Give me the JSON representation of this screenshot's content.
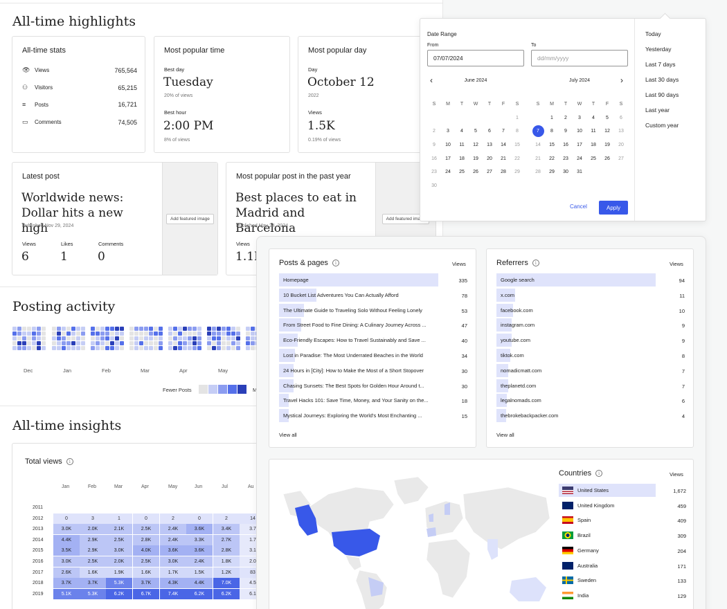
{
  "highlights": {
    "title": "All-time highlights",
    "stats": {
      "title": "All-time stats",
      "rows": [
        {
          "icon": "eye-icon",
          "label": "Views",
          "value": "765,564"
        },
        {
          "icon": "visitors-icon",
          "label": "Visitors",
          "value": "65,215"
        },
        {
          "icon": "posts-icon",
          "label": "Posts",
          "value": "16,721"
        },
        {
          "icon": "comments-icon",
          "label": "Comments",
          "value": "74,505"
        }
      ]
    },
    "popular_time": {
      "title": "Most popular time",
      "best_day_label": "Best day",
      "best_day": "Tuesday",
      "best_day_pct": "20% of views",
      "best_hour_label": "Best hour",
      "best_hour": "2:00 PM",
      "best_hour_pct": "8% of views"
    },
    "popular_day": {
      "title": "Most popular day",
      "day_label": "Day",
      "day": "October 12",
      "year": "2022",
      "views_label": "Views",
      "views": "1.5K",
      "views_pct": "0.19% of views"
    },
    "latest_post": {
      "title": "Latest post",
      "headline": "Worldwide news: Dollar hits a new high",
      "published": "Published Nov 29, 2024",
      "add_image": "Add featured image",
      "metrics": [
        {
          "label": "Views",
          "value": "6"
        },
        {
          "label": "Likes",
          "value": "1"
        },
        {
          "label": "Comments",
          "value": "0"
        }
      ]
    },
    "popular_post": {
      "title": "Most popular post in the past year",
      "headline": "Best places to eat in Madrid and Barcelona",
      "published": "Published May 24, 2024",
      "add_image": "Add featured image",
      "views_label": "Views",
      "views": "1.1K"
    }
  },
  "posting_activity": {
    "title": "Posting activity",
    "months": [
      "Dec",
      "Jan",
      "Feb",
      "Mar",
      "Apr",
      "May"
    ],
    "legend_low": "Fewer Posts",
    "legend_high": "M"
  },
  "insights": {
    "title": "All-time insights",
    "total_views_title": "Total views",
    "months": [
      "Jan",
      "Feb",
      "Mar",
      "Apr",
      "May",
      "Jun",
      "Jul",
      "Au"
    ],
    "years": [
      "2011",
      "2012",
      "2013",
      "2014",
      "2015",
      "2016",
      "2017",
      "2018",
      "2019"
    ],
    "rows": [
      [
        "",
        "",
        "",
        "",
        "",
        "",
        "",
        ""
      ],
      [
        "0",
        "3",
        "1",
        "0",
        "2",
        "0",
        "2",
        "14"
      ],
      [
        "3.0K",
        "2.0K",
        "2.1K",
        "2.5K",
        "2.4K",
        "3.6K",
        "3.4K",
        "3.7"
      ],
      [
        "4.4K",
        "2.9K",
        "2.5K",
        "2.8K",
        "2.4K",
        "3.3K",
        "2.7K",
        "1.7"
      ],
      [
        "3.5K",
        "2.9K",
        "3.0K",
        "4.0K",
        "3.6K",
        "3.6K",
        "2.8K",
        "3.1"
      ],
      [
        "3.0K",
        "2.5K",
        "2.0K",
        "2.5K",
        "3.0K",
        "2.4K",
        "1.8K",
        "2.0"
      ],
      [
        "2.6K",
        "1.6K",
        "1.9K",
        "1.6K",
        "1.7K",
        "1.5K",
        "1.2K",
        "83"
      ],
      [
        "3.7K",
        "3.7K",
        "5.3K",
        "3.7K",
        "4.3K",
        "4.4K",
        "7.0K",
        "4.5"
      ],
      [
        "5.1K",
        "5.3K",
        "6.2K",
        "6.7K",
        "7.4K",
        "6.2K",
        "6.2K",
        "6.1"
      ]
    ]
  },
  "datepicker": {
    "range_label": "Date Range",
    "from_label": "From",
    "from_value": "07/07/2024",
    "to_label": "To",
    "to_placeholder": "dd/mm/yyyy",
    "left_month": "June 2024",
    "right_month": "July 2024",
    "weekdays": [
      "S",
      "M",
      "T",
      "W",
      "T",
      "F",
      "S"
    ],
    "june_days": [
      "",
      "",
      "",
      "",
      "",
      "",
      "1",
      "2",
      "3",
      "4",
      "5",
      "6",
      "7",
      "8",
      "9",
      "10",
      "11",
      "12",
      "13",
      "14",
      "15",
      "16",
      "17",
      "18",
      "19",
      "20",
      "21",
      "22",
      "23",
      "24",
      "25",
      "26",
      "27",
      "28",
      "29",
      "30"
    ],
    "july_days": [
      "",
      "1",
      "2",
      "3",
      "4",
      "5",
      "6",
      "7",
      "8",
      "9",
      "10",
      "11",
      "12",
      "13",
      "14",
      "15",
      "16",
      "17",
      "18",
      "19",
      "20",
      "21",
      "22",
      "23",
      "24",
      "25",
      "26",
      "27",
      "28",
      "29",
      "30",
      "31"
    ],
    "selected_day": "7",
    "cancel_label": "Cancel",
    "apply_label": "Apply",
    "presets": [
      "Today",
      "Yesterday",
      "Last 7 days",
      "Last 30 days",
      "Last 90 days",
      "Last year",
      "Custom year"
    ]
  },
  "posts_pages": {
    "title": "Posts & pages",
    "views_header": "Views",
    "rows": [
      {
        "label": "Homepage",
        "value": "335"
      },
      {
        "label": "10 Bucket List Adventures You Can Actually Afford",
        "value": "78"
      },
      {
        "label": "The Ultimate Guide to Traveling Solo Without Feeling Lonely",
        "value": "53"
      },
      {
        "label": "From Street Food to Fine Dining: A Culinary Journey Across ...",
        "value": "47"
      },
      {
        "label": "Eco-Friendly Escapes: How to Travel Sustainably and Save ...",
        "value": "40"
      },
      {
        "label": "Lost in Paradise: The Most Underrated Beaches in the World",
        "value": "34"
      },
      {
        "label": "24 Hours in [City]: How to Make the Most of a Short Stopover",
        "value": "30"
      },
      {
        "label": "Chasing Sunsets: The Best Spots for Golden Hour Around t...",
        "value": "30"
      },
      {
        "label": "Travel Hacks 101: Save Time, Money, and Your Sanity on the...",
        "value": "18"
      },
      {
        "label": "Mystical Journeys: Exploring the World's Most Enchanting ...",
        "value": "15"
      }
    ],
    "view_all": "View all"
  },
  "referrers": {
    "title": "Referrers",
    "views_header": "Views",
    "rows": [
      {
        "label": "Google search",
        "value": "94"
      },
      {
        "label": "x.com",
        "value": "11"
      },
      {
        "label": "facebook.com",
        "value": "10"
      },
      {
        "label": "instagram.com",
        "value": "9"
      },
      {
        "label": "youtube.com",
        "value": "9"
      },
      {
        "label": "tiktok.com",
        "value": "8"
      },
      {
        "label": "nomadicmatt.com",
        "value": "7"
      },
      {
        "label": "theplanetd.com",
        "value": "7"
      },
      {
        "label": "legalnomads.com",
        "value": "6"
      },
      {
        "label": "thebrokebackpacker.com",
        "value": "4"
      }
    ],
    "view_all": "View all"
  },
  "countries": {
    "title": "Countries",
    "views_header": "Views",
    "rows": [
      {
        "label": "United States",
        "value": "1,672",
        "flag": "us"
      },
      {
        "label": "United Kingdom",
        "value": "459",
        "flag": "gb"
      },
      {
        "label": "Spain",
        "value": "409",
        "flag": "es"
      },
      {
        "label": "Brazil",
        "value": "309",
        "flag": "br"
      },
      {
        "label": "Germany",
        "value": "204",
        "flag": "de"
      },
      {
        "label": "Australia",
        "value": "171",
        "flag": "au"
      },
      {
        "label": "Sweden",
        "value": "133",
        "flag": "se"
      },
      {
        "label": "India",
        "value": "129",
        "flag": "in"
      }
    ]
  },
  "colors": {
    "accent": "#3858e9",
    "bar_bg": "#dfe3fb"
  }
}
